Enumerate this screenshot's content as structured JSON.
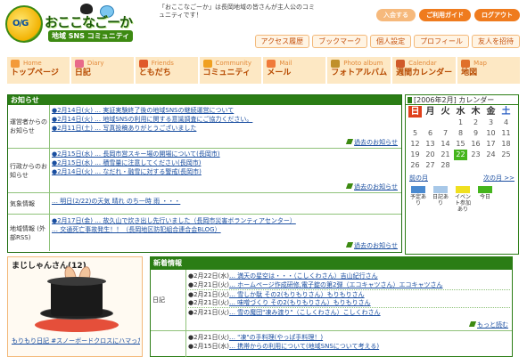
{
  "header": {
    "logo_badge": "O/G",
    "logo_title": "おここなごーか",
    "logo_subtitle": "地域 SNS コミュニティ",
    "intro": "「おここなごーか」は長岡地域の皆さんが主人公のコミュニティです！",
    "top_buttons": [
      "入会する",
      "ご利用ガイド",
      "ログアウト"
    ],
    "sub_nav": [
      "アクセス履歴",
      "ブックマーク",
      "個人設定",
      "プロフィール",
      "友人を招待"
    ]
  },
  "main_nav": [
    {
      "en": "Home",
      "ja": "トップページ",
      "icon_color": "#f39a3a"
    },
    {
      "en": "Diary",
      "ja": "日記",
      "icon_color": "#e86a8a"
    },
    {
      "en": "Friends",
      "ja": "ともだち",
      "icon_color": "#e05a2a"
    },
    {
      "en": "Community",
      "ja": "コミュニティ",
      "icon_color": "#f0a020"
    },
    {
      "en": "Mail",
      "ja": "メール",
      "icon_color": "#f07a3a"
    },
    {
      "en": "Photo album",
      "ja": "フォトアルバム",
      "icon_color": "#c0902a"
    },
    {
      "en": "Calendar",
      "ja": "週間カレンダー",
      "icon_color": "#d05a2a"
    },
    {
      "en": "Map",
      "ja": "地図",
      "icon_color": "#e0702a"
    }
  ],
  "news": {
    "title": "お知らせ",
    "more_label": "過去のお知らせ",
    "sections": [
      {
        "label": "運営者からのお知らせ",
        "items": [
          {
            "text": "●2月14日(火) … 実証実験終了後の地域SNSの継続運営について"
          },
          {
            "text": "●2月14日(火) … 地域SNSの利用に関する意識調査にご協力ください。"
          },
          {
            "text": "●2月11日(土) … 写真投稿ありがとうございました"
          }
        ]
      },
      {
        "label": "行政からのお知らせ",
        "items": [
          {
            "text": "●2月15日(水) … 長岡市営スキー場の開場について(長岡市)"
          },
          {
            "text": "●2月15日(水) … 積雪量に注意してください(長岡市)"
          },
          {
            "text": "●2月14日(火) … なだれ・融雪に対する警戒(長岡市)"
          }
        ]
      },
      {
        "label": "気象情報",
        "items": [
          {
            "text": "… 明日(2/22)の天気 晴れ のち一時 雨 ・・・"
          }
        ]
      },
      {
        "label": "地域情報 (外部RSS)",
        "items": [
          {
            "text": "●2月17日(金) … 故久山で炊き出し先行いました（長岡市災害ボランティアセンター）"
          },
          {
            "text": "… 交通死亡事故発生！！（長岡地区防犯組合連合会BLOG）"
          }
        ]
      }
    ]
  },
  "calendar": {
    "title": "[2006年2月] カレンダー",
    "weekdays": [
      "日",
      "月",
      "火",
      "水",
      "木",
      "金",
      "土"
    ],
    "days": [
      "",
      "",
      "",
      "1",
      "2",
      "3",
      "4",
      "5",
      "6",
      "7",
      "8",
      "9",
      "10",
      "11",
      "12",
      "13",
      "14",
      "15",
      "16",
      "17",
      "18",
      "19",
      "20",
      "21",
      "22",
      "23",
      "24",
      "25",
      "26",
      "27",
      "28",
      "",
      "",
      "",
      ""
    ],
    "today": "22",
    "prev_label": "前の月",
    "next_label": "次の月 >>",
    "legend": [
      {
        "label": "予定あり",
        "color": "#4a8ad0"
      },
      {
        "label": "日記あり",
        "color": "#a8c8e8"
      },
      {
        "label": "イベント参加あり",
        "color": "#f0e020"
      },
      {
        "label": "今日",
        "color": "#45b51d"
      }
    ]
  },
  "profile": {
    "name": "まじしゃんさん(12)",
    "text": "もりもり日記 #スノーボードクロスにハマった"
  },
  "new_info": {
    "title": "新着情報",
    "sections": [
      {
        "label": "日記",
        "more": "もっと読む",
        "items": [
          {
            "date": "●2月22日(水)",
            "text": "… 満天の星空は・・・（こしくわさん）吉山紀行さん"
          },
          {
            "date": "●2月21日(火)",
            "text": "… ホームページ作成研修,電子錠の第2弾（エコキャツさん）エコキャツさん"
          },
          {
            "date": "●2月21日(火)",
            "text": "… 雪しか駄 その2(もりもりさん）もりもりさん"
          },
          {
            "date": "●2月21日(火)",
            "text": "… 味噌づくり その2(もりもりさん）もりもりさん"
          },
          {
            "date": "●2月21日(火)",
            "text": "… 雪の魔団\"凍み渡り\"（こしくわさん）こしくわさん"
          }
        ]
      },
      {
        "label": "",
        "more": "",
        "items": [
          {
            "date": "●2月21日(火)",
            "text": "… \"凍\"の手料理(やっぱ手料理！)"
          },
          {
            "date": "●2月15日(水)",
            "text": "… 携帯からの利用について(地域SNSについて考える)"
          }
        ]
      }
    ]
  }
}
